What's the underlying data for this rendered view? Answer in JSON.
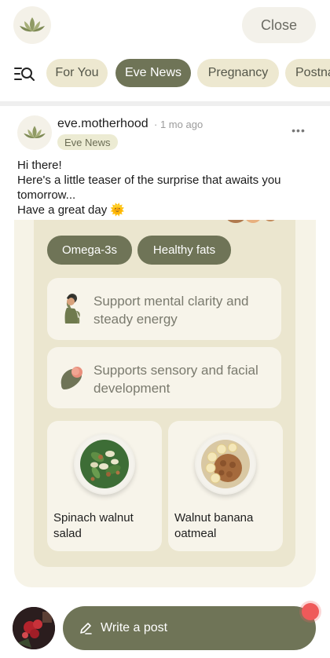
{
  "header": {
    "logo_icon": "lotus-icon",
    "close_label": "Close"
  },
  "tabs": {
    "search_icon": "menu-search-icon",
    "items": [
      {
        "label": "For You",
        "active": false
      },
      {
        "label": "Eve News",
        "active": true
      },
      {
        "label": "Pregnancy",
        "active": false
      },
      {
        "label": "Postna",
        "active": false
      }
    ]
  },
  "post": {
    "author": "eve.motherhood",
    "separator": "·",
    "time": "1 mo ago",
    "badge": "Eve News",
    "more_icon": "more-dots-icon",
    "more_label": "•••",
    "lines": [
      "Hi there!",
      "Here's a little teaser of the surprise that awaits you",
      "tomorrow...",
      "Have a great day 🌞"
    ],
    "card": {
      "chips": [
        "Omega-3s",
        "Healthy fats"
      ],
      "benefits": [
        {
          "text": "Support mental clarity and steady energy",
          "icon": "pregnant-woman-icon"
        },
        {
          "text": "Supports sensory and facial development",
          "icon": "fetus-icon"
        }
      ],
      "recipes": [
        {
          "name": "Spinach walnut salad",
          "icon": "salad-bowl-icon"
        },
        {
          "name": "Walnut banana oatmeal",
          "icon": "oatmeal-bowl-icon"
        }
      ]
    }
  },
  "footer": {
    "write_label": "Write a post",
    "pen_icon": "pen-icon"
  },
  "colors": {
    "accent": "#6f7457",
    "chip_bg": "#ede8d0",
    "card_bg": "#ebe6cf",
    "notification": "#ef5a5a"
  }
}
